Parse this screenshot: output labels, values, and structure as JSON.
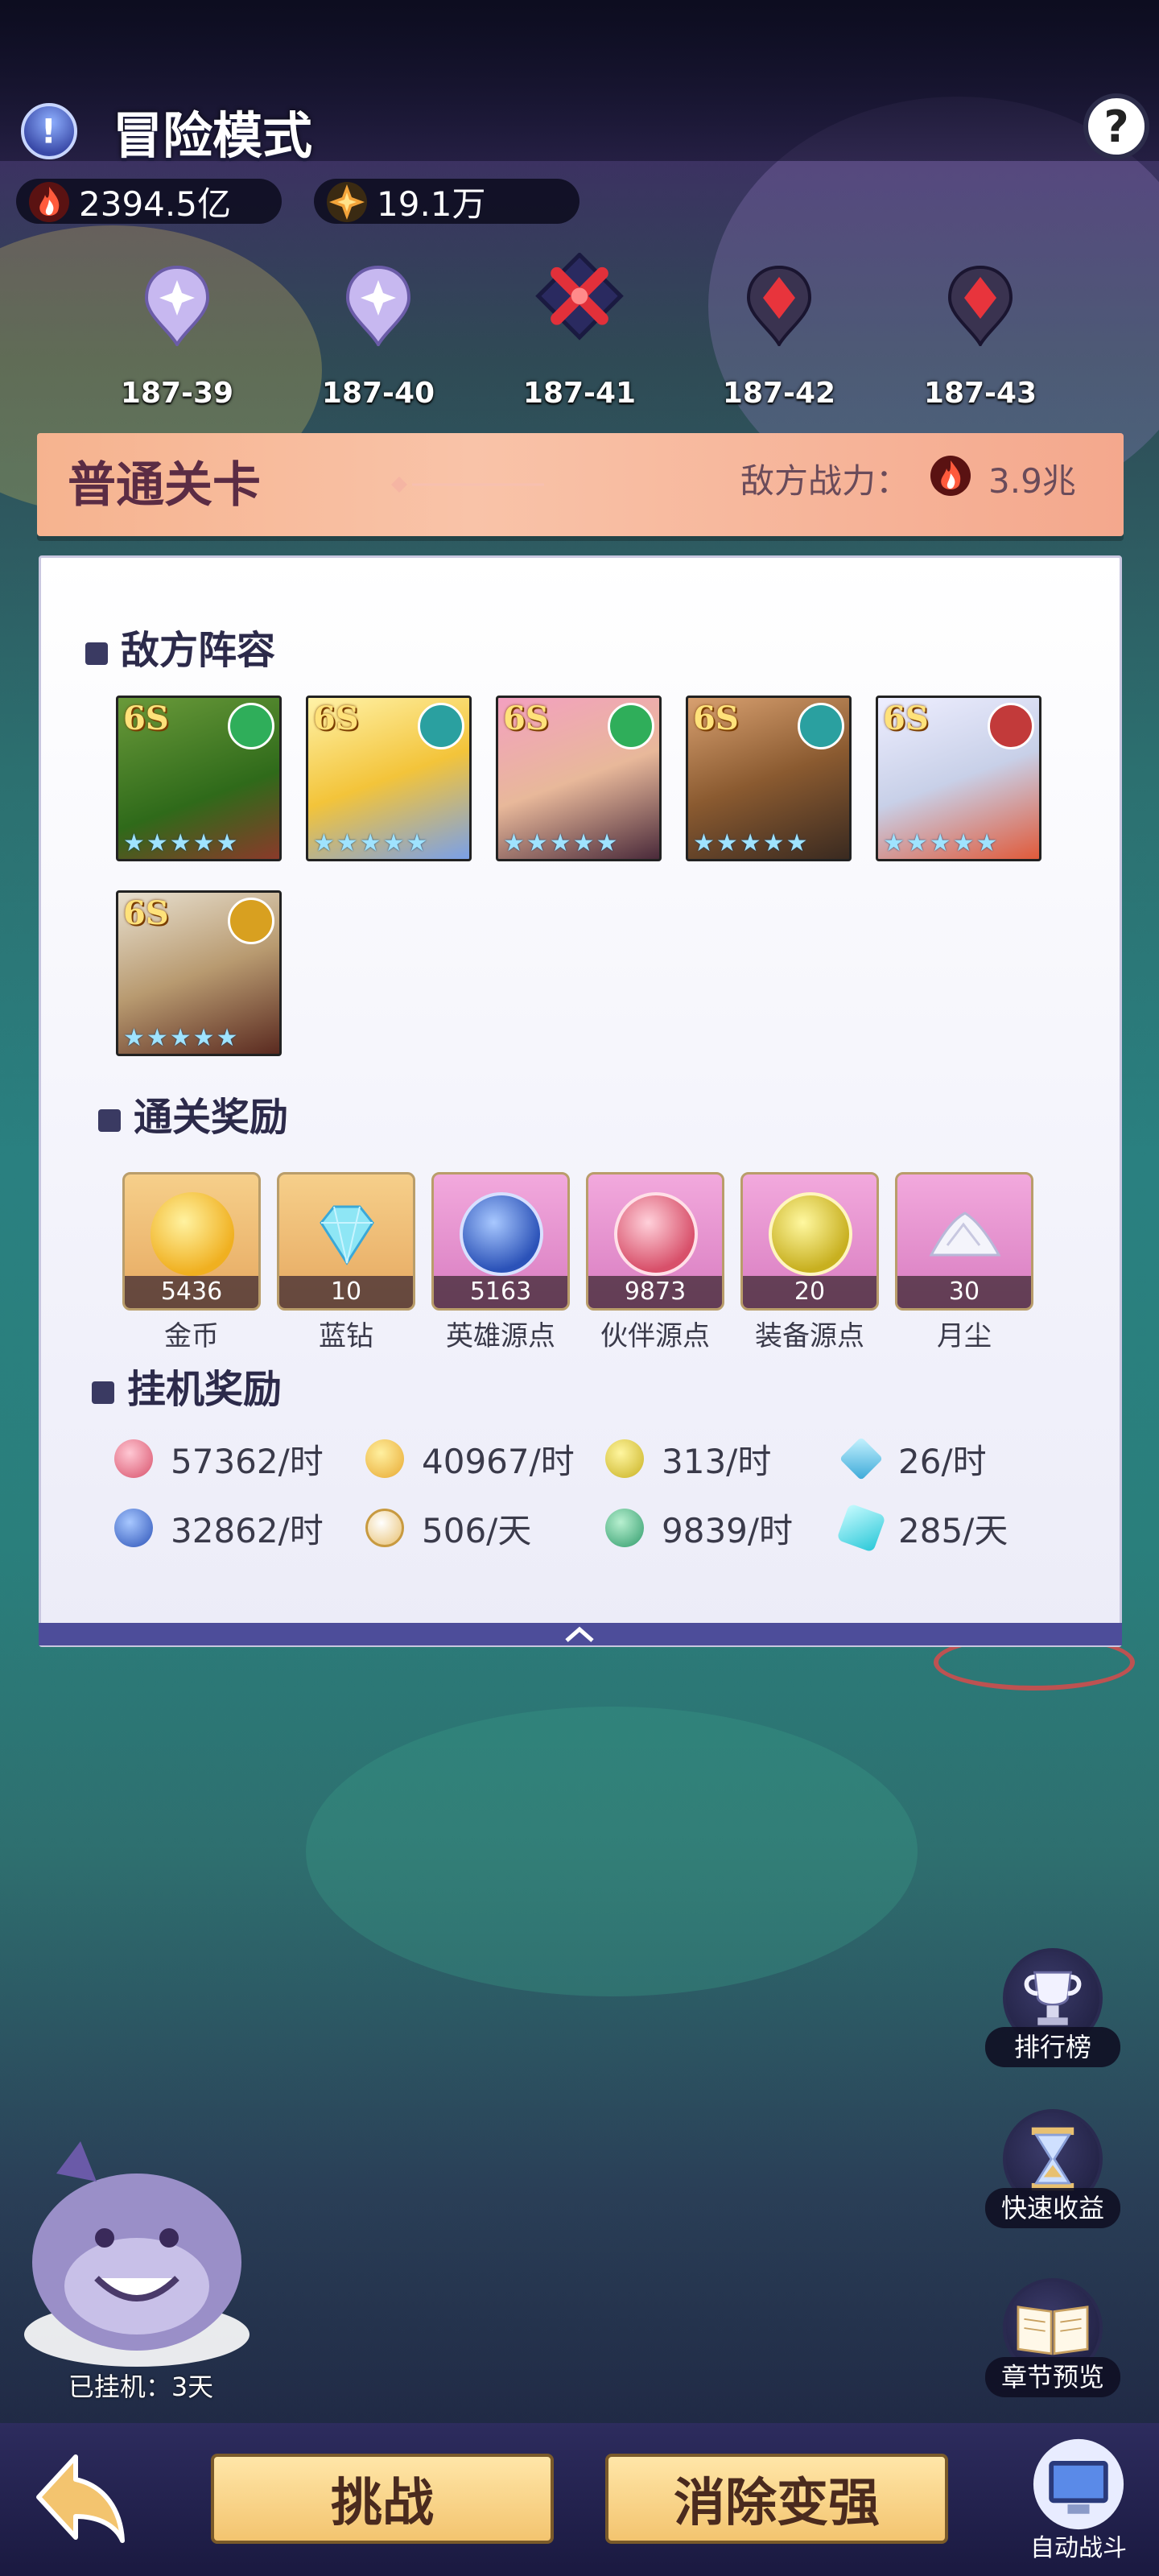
{
  "header": {
    "title": "冒险模式",
    "info_icon": "exclamation-icon",
    "help_icon": "question-icon"
  },
  "resources": [
    {
      "icon": "fire-power-icon",
      "value": "2394.5亿"
    },
    {
      "icon": "star-crystal-icon",
      "value": "19.1万"
    }
  ],
  "stages": [
    {
      "label": "187-39",
      "state": "cleared"
    },
    {
      "label": "187-40",
      "state": "cleared"
    },
    {
      "label": "187-41",
      "state": "current"
    },
    {
      "label": "187-42",
      "state": "locked"
    },
    {
      "label": "187-43",
      "state": "locked"
    }
  ],
  "banner": {
    "title": "普通关卡",
    "enemy_power_label": "敌方战力：",
    "enemy_power_value": "3.9兆"
  },
  "enemy_section": {
    "title": "敌方阵容",
    "heroes": [
      {
        "tag": "6S",
        "faction_color": "#2fae5a",
        "name": "goblin-hero"
      },
      {
        "tag": "6S",
        "faction_color": "#2aa0a0",
        "name": "blonde-hero"
      },
      {
        "tag": "6S",
        "faction_color": "#2fae5a",
        "name": "dark-hair-hero"
      },
      {
        "tag": "6S",
        "faction_color": "#2aa0a0",
        "name": "beast-hero"
      },
      {
        "tag": "6S",
        "faction_color": "#c23a3a",
        "name": "silver-hair-hero"
      },
      {
        "tag": "6S",
        "faction_color": "#d8a020",
        "name": "hat-hero"
      }
    ],
    "stars": "★★★★★"
  },
  "clear_rewards": {
    "title": "通关奖励",
    "items": [
      {
        "count": "5436",
        "label": "金币",
        "bg": "#f1c06e",
        "orb": "#f7d04a",
        "icon": "gold-coin-icon"
      },
      {
        "count": "10",
        "label": "蓝钻",
        "bg": "#f1c06e",
        "orb": "#8ee6f5",
        "icon": "diamond-icon"
      },
      {
        "count": "5163",
        "label": "英雄源点",
        "bg": "#e79ad3",
        "orb": "#3b6fd6",
        "icon": "hero-essence-icon"
      },
      {
        "count": "9873",
        "label": "伙伴源点",
        "bg": "#e79ad3",
        "orb": "#e0607a",
        "icon": "partner-essence-icon"
      },
      {
        "count": "20",
        "label": "装备源点",
        "bg": "#e79ad3",
        "orb": "#d6c22a",
        "icon": "gear-essence-icon"
      },
      {
        "count": "30",
        "label": "月尘",
        "bg": "#e79ad3",
        "orb": "#f1f1f6",
        "icon": "moon-dust-icon"
      }
    ]
  },
  "idle_rewards": {
    "title": "挂机奖励",
    "rows": [
      [
        {
          "value": "57362/时",
          "color": "#e0607a",
          "icon": "partner-essence-icon"
        },
        {
          "value": "40967/时",
          "color": "#f0b940",
          "icon": "gold-coin-icon"
        },
        {
          "value": "313/时",
          "color": "#d6c22a",
          "icon": "gear-essence-icon"
        },
        {
          "value": "26/时",
          "color": "#6fd3f0",
          "icon": "diamond-icon"
        }
      ],
      [
        {
          "value": "32862/时",
          "color": "#3b6fd6",
          "icon": "hero-essence-icon"
        },
        {
          "value": "506/天",
          "color": "#f3c46f",
          "icon": "orb-icon"
        },
        {
          "value": "9839/时",
          "color": "#3faa7a",
          "icon": "temple-icon"
        },
        {
          "value": "285/天",
          "color": "#4dd8e8",
          "icon": "crystal-icon"
        }
      ]
    ]
  },
  "side_buttons": [
    {
      "label": "排行榜",
      "icon": "trophy-icon"
    },
    {
      "label": "快速收益",
      "icon": "hourglass-icon"
    },
    {
      "label": "章节预览",
      "icon": "book-icon"
    }
  ],
  "idle_status": "已挂机：3天",
  "bottom": {
    "back_icon": "back-arrow-icon",
    "challenge": "挑战",
    "upgrade": "消除变强",
    "auto_label": "自动战斗"
  }
}
